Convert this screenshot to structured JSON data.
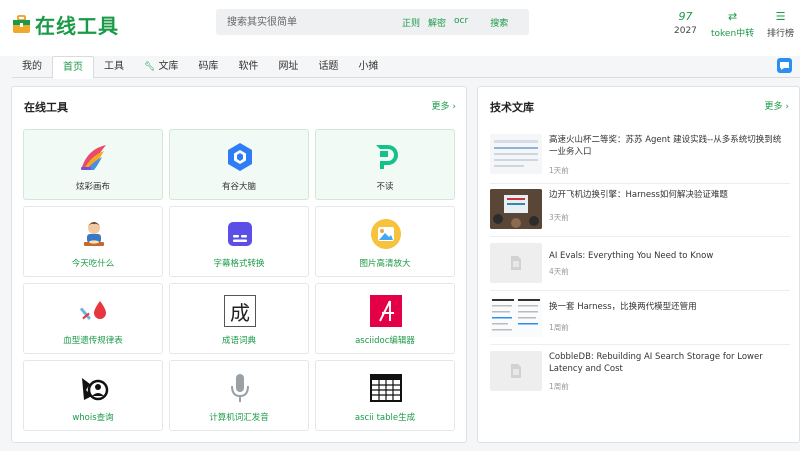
{
  "header": {
    "logo_text": "在线工具",
    "search_placeholder": "搜索其实很简单",
    "search_tags": [
      "正则",
      "解密",
      "ocr"
    ],
    "search_button": "搜索",
    "stats": [
      {
        "top": "97",
        "bottom": "2027"
      },
      {
        "top": "⇄",
        "bottom": "token中转"
      },
      {
        "top": "☰",
        "bottom": "排行榜"
      }
    ]
  },
  "nav": {
    "items": [
      "我的",
      "首页",
      "工具",
      "文库",
      "码库",
      "软件",
      "网址",
      "话题",
      "小摊"
    ],
    "active": "首页"
  },
  "tools": {
    "title": "在线工具",
    "more": "更多 ›",
    "items": [
      {
        "label": "炫彩画布"
      },
      {
        "label": "有谷大脑"
      },
      {
        "label": "不读"
      },
      {
        "label": "今天吃什么"
      },
      {
        "label": "字幕格式转换"
      },
      {
        "label": "图片高清放大"
      },
      {
        "label": "血型遗传规律表"
      },
      {
        "label": "成语词典"
      },
      {
        "label": "asciidoc编辑器"
      },
      {
        "label": "whois查询"
      },
      {
        "label": "计算机词汇发音"
      },
      {
        "label": "ascii table生成"
      }
    ],
    "icon_char_chengyu": "成"
  },
  "library": {
    "title": "技术文库",
    "more": "更多 ›",
    "articles": [
      {
        "title": "高速火山杯二等奖：苏苏 Agent 建设实践--从多系统切换到统一业务入口",
        "time": "1天前"
      },
      {
        "title": "边开飞机边换引擎：Harness如何解决验证难题",
        "time": "3天前"
      },
      {
        "title": "AI Evals: Everything You Need to Know",
        "time": "4天前"
      },
      {
        "title": "换一套 Harness，比换两代模型还管用",
        "time": "1周前"
      },
      {
        "title": "CobbleDB: Rebuilding AI Search Storage for Lower Latency and Cost",
        "time": "1周前"
      }
    ]
  },
  "colors": {
    "brand": "#1a9a47",
    "accent_blue": "#2b8ff0"
  }
}
